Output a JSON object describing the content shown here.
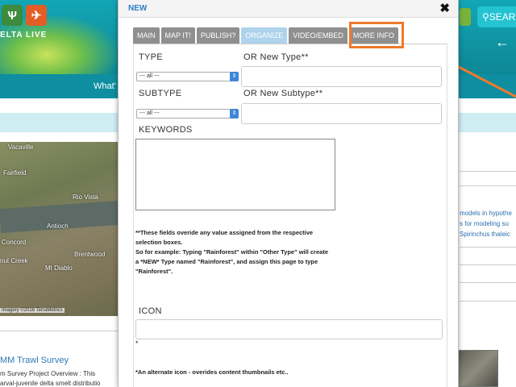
{
  "background": {
    "logo_text": "ELTA LIVE",
    "nav_text": "What'",
    "search_label": "SEAR",
    "map_labels": [
      "Vacaville",
      "Fairfield",
      "Rio Vista",
      "Antioch",
      "Concord",
      "Brentwood",
      "nut Creek",
      "Mt Diablo"
    ],
    "map_attribution": "Imagery ©2016 TerraMetrics",
    "article_link": "MM Trawl Survey",
    "article_line_1": "m  Survey  Project  Overview  :  This",
    "article_line_2": "arval-juvenile  delta  smelt  distributio",
    "right_col": [
      "models in hypothe",
      "s for modeling su",
      "Spirinchus thaleic"
    ]
  },
  "modal": {
    "title": "NEW",
    "close_symbol": "✖",
    "tabs": [
      {
        "label": "MAIN"
      },
      {
        "label": "MAP IT!"
      },
      {
        "label": "PUBLISH?"
      },
      {
        "label": "ORGANIZE"
      },
      {
        "label": "VIDEO/EMBED"
      },
      {
        "label": "MORE INFO"
      }
    ],
    "active_tab": "ORGANIZE",
    "type_label": "TYPE",
    "new_type_label": "OR New Type**",
    "type_select_value": "--- all ---",
    "subtype_label": "SUBTYPE",
    "new_subtype_label": "OR New Subtype**",
    "subtype_select_value": "--- all ---",
    "keywords_label": "KEYWORDS",
    "note_line_1": "**These fields overide any value assigned from the respective",
    "note_line_2": "selection boxes.",
    "note_line_3": "So for example: Typing \"Rainforest\" within \"Other Type\" will create",
    "note_line_4": "a *NEW* Type named \"Rainforest\", and assign this page to type",
    "note_line_5": "\"Rainforest\".",
    "icon_label": "ICON",
    "icon_asterisk": "*",
    "icon_note": "*An alternate icon - overides content thumbnails etc.."
  },
  "colors": {
    "accent_orange": "#ef7a2a",
    "active_tab": "#aed3ec",
    "inactive_tab": "#8f8f8f",
    "header_teal": "#13a6b5"
  }
}
